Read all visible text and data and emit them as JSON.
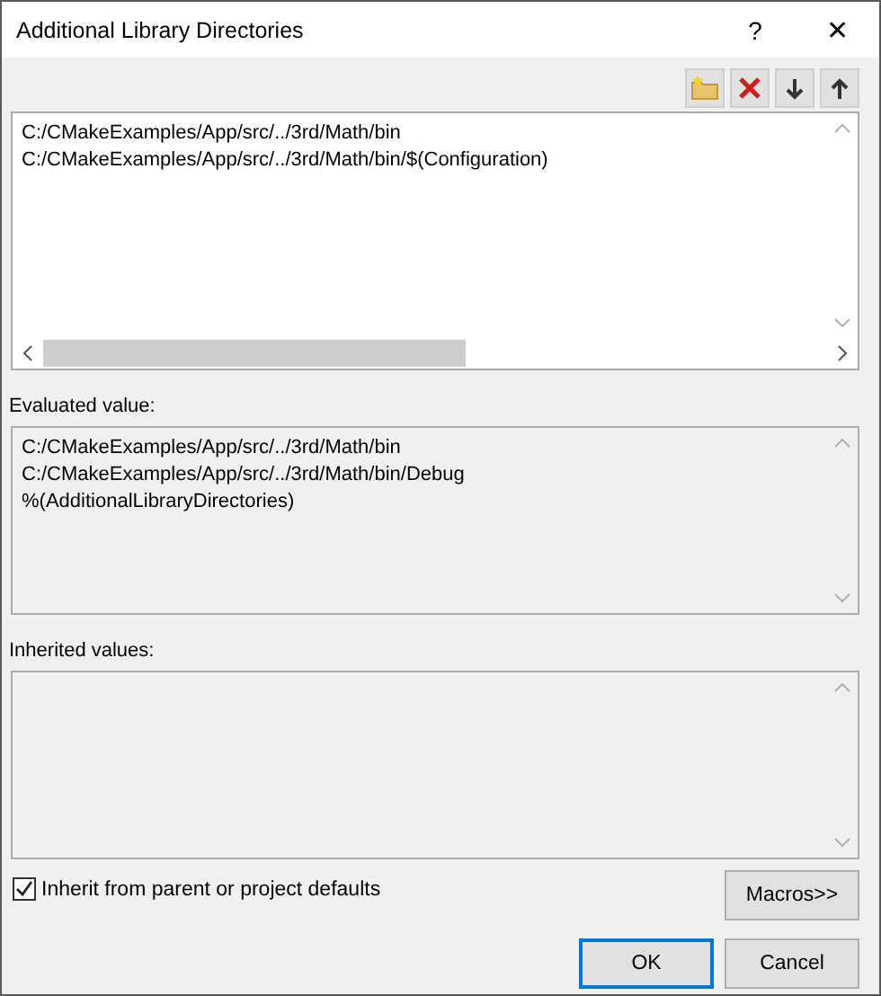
{
  "window": {
    "title": "Additional Library Directories",
    "help": "?",
    "close": "✕"
  },
  "directories": {
    "lines": [
      "C:/CMakeExamples/App/src/../3rd/Math/bin",
      "C:/CMakeExamples/App/src/../3rd/Math/bin/$(Configuration)"
    ]
  },
  "evaluated": {
    "label": "Evaluated value:",
    "lines": [
      "C:/CMakeExamples/App/src/../3rd/Math/bin",
      "C:/CMakeExamples/App/src/../3rd/Math/bin/Debug",
      "%(AdditionalLibraryDirectories)"
    ]
  },
  "inherited": {
    "label": "Inherited values:"
  },
  "inherit_checkbox": {
    "label": "Inherit from parent or project defaults",
    "checked": true
  },
  "macros_button": {
    "label": "Macros>>"
  },
  "buttons": [
    {
      "label": "OK",
      "default": true
    },
    {
      "label": "Cancel",
      "default": false
    }
  ]
}
